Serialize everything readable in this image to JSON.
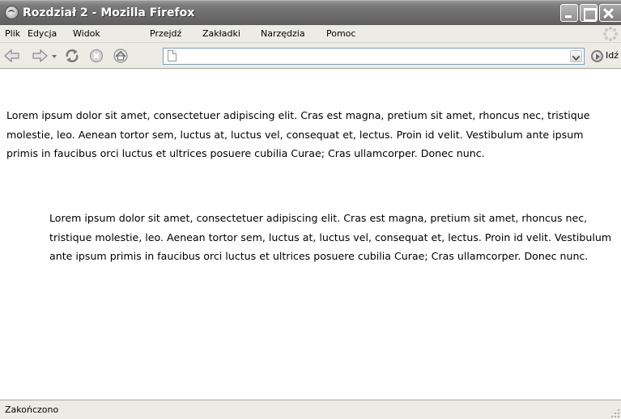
{
  "window": {
    "title": "Rozdział 2 - Mozilla Firefox"
  },
  "menu": {
    "items": [
      "Plik",
      "Edycja",
      "Widok",
      "Przejdź",
      "Zakładki",
      "Narzędzia",
      "Pomoc"
    ]
  },
  "nav": {
    "back_icon": "back-arrow-icon",
    "forward_icon": "forward-arrow-icon",
    "reload_icon": "reload-icon",
    "stop_icon": "stop-icon",
    "home_icon": "home-icon",
    "url_value": "",
    "go_label": "Idź"
  },
  "content": {
    "paragraph1": "Lorem ipsum dolor sit amet, consectetuer adipiscing elit. Cras est magna, pretium sit amet, rhoncus nec, tristique molestie, leo. Aenean tortor sem, luctus at, luctus vel, consequat et, lectus. Proin id velit. Vestibulum ante ipsum primis in faucibus orci luctus et ultrices posuere cubilia Curae; Cras ullamcorper. Donec nunc.",
    "paragraph2": "Lorem ipsum dolor sit amet, consectetuer adipiscing elit. Cras est magna, pretium sit amet, rhoncus nec, tristique molestie, leo. Aenean tortor sem, luctus at, luctus vel, consequat et, lectus. Proin id velit. Vestibulum ante ipsum primis in faucibus orci luctus et ultrices posuere cubilia Curae; Cras ullamcorper. Donec nunc."
  },
  "status": {
    "text": "Zakończono"
  }
}
